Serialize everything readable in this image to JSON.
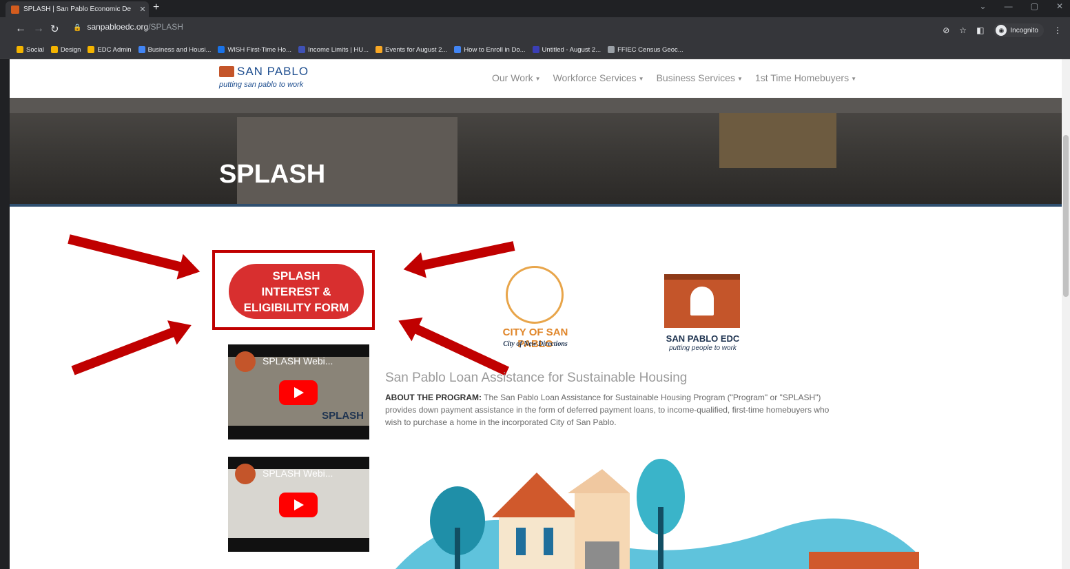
{
  "browser": {
    "tab_title": "SPLASH | San Pablo Economic De",
    "tab_close": "✕",
    "new_tab": "+",
    "url_domain": "sanpabloedc.org",
    "url_path": "/SPLASH",
    "incognito_label": "Incognito",
    "bookmarks": [
      {
        "label": "Social",
        "color": "#f4b400"
      },
      {
        "label": "Design",
        "color": "#f4b400"
      },
      {
        "label": "EDC Admin",
        "color": "#f4b400"
      },
      {
        "label": "Business and Housi...",
        "color": "#4285f4"
      },
      {
        "label": "WISH First-Time Ho...",
        "color": "#1a73e8"
      },
      {
        "label": "Income Limits | HU...",
        "color": "#3f51b5"
      },
      {
        "label": "Events for August 2...",
        "color": "#f9a825"
      },
      {
        "label": "How to Enroll in Do...",
        "color": "#4285f4"
      },
      {
        "label": "Untitled - August 2...",
        "color": "#3b3fb6"
      },
      {
        "label": "FFIEC Census Geoc...",
        "color": "#9aa0a6"
      }
    ]
  },
  "site": {
    "logo_name": "SAN PABLO",
    "logo_tagline": "putting san pablo to work",
    "nav": [
      {
        "label": "Our Work"
      },
      {
        "label": "Workforce Services"
      },
      {
        "label": "Business Services"
      },
      {
        "label": "1st Time Homebuyers"
      }
    ],
    "hero_title": "SPLASH"
  },
  "content": {
    "form_button_lines": [
      "SPLASH",
      "INTEREST &",
      "ELIGIBILITY FORM"
    ],
    "videos": [
      {
        "title": "SPLASH Webi...",
        "brand": "SPLASH"
      },
      {
        "title": "SPLASH Webi...",
        "brand": ""
      }
    ],
    "city_logo_name": "CITY OF SAN PABLO",
    "city_logo_sub": "City of New Directions",
    "edc_logo_name": "SAN PABLO EDC",
    "edc_logo_sub": "putting people to work",
    "program_title": "San Pablo Loan Assistance for Sustainable Housing",
    "about_label": "ABOUT THE PROGRAM:",
    "about_text": " The San Pablo Loan Assistance for Sustainable Housing Program (\"Program\" or \"SPLASH\") provides down payment assistance in the form of deferred payment loans, to income-qualified, first-time homebuyers who wish to purchase a home in the incorporated City of San Pablo."
  }
}
